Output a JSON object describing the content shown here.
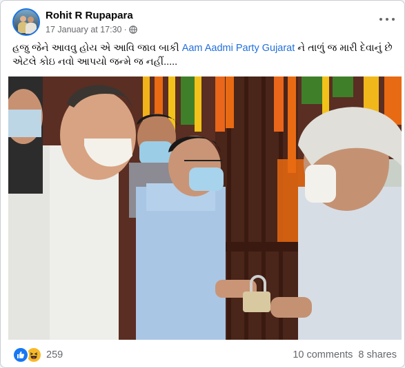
{
  "post": {
    "author": "Rohit R Rupapara",
    "timestamp": "17 January at 17:30",
    "separator": "·",
    "audience_icon": "globe-icon",
    "text_before": "હજુ જેને આવવુ હોય એ આવિ જાવ બાકી ",
    "mention": "Aam Aadmi Party Gujarat",
    "text_after": " ને તાળું જ મારી દેવાનું છે એટલે કોઇ નવો આપયો જન્મે જ નહીં.....",
    "photo_description_icon": "photo"
  },
  "reactions": {
    "icons": [
      "like-icon",
      "haha-icon"
    ],
    "count": "259"
  },
  "engagement": {
    "comments": "10 comments",
    "shares": "8 shares"
  },
  "colors": {
    "mention": "#216fdb",
    "like": "#1877f2",
    "haha": "#f7b928",
    "muted": "#65676b"
  }
}
